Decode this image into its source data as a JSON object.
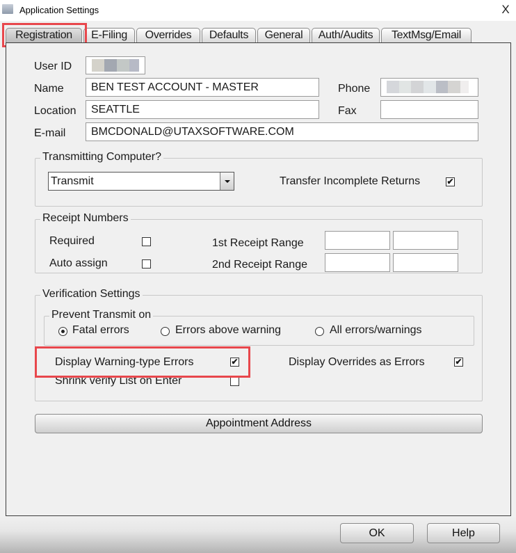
{
  "window": {
    "title": "Application Settings",
    "close_glyph": "X",
    "icon": "app-window-icon"
  },
  "tabs": [
    {
      "label": "Registration",
      "active": true,
      "highlighted": true
    },
    {
      "label": "E-Filing",
      "active": false
    },
    {
      "label": "Overrides",
      "active": false
    },
    {
      "label": "Defaults",
      "active": false
    },
    {
      "label": "General",
      "active": false
    },
    {
      "label": "Auth/Audits",
      "active": false
    },
    {
      "label": "TextMsg/Email",
      "active": false
    }
  ],
  "user": {
    "user_id_label": "User ID",
    "user_id_value": "",
    "user_id_redacted": true,
    "name_label": "Name",
    "name_value": "BEN TEST ACCOUNT - MASTER",
    "phone_label": "Phone",
    "phone_value": "",
    "phone_redacted": true,
    "location_label": "Location",
    "location_value": "SEATTLE",
    "fax_label": "Fax",
    "fax_value": "",
    "email_label": "E-mail",
    "email_value": "BMCDONALD@UTAXSOFTWARE.COM"
  },
  "transmitting": {
    "group_title": "Transmitting Computer?",
    "selected": "Transmit",
    "transfer_incomplete_label": "Transfer Incomplete Returns",
    "transfer_incomplete_checked": true
  },
  "receipt": {
    "group_title": "Receipt Numbers",
    "required_label": "Required",
    "required_checked": false,
    "auto_assign_label": "Auto assign",
    "auto_assign_checked": false,
    "range1_label": "1st Receipt Range",
    "range1_from": "",
    "range1_to": "",
    "range2_label": "2nd Receipt Range",
    "range2_from": "",
    "range2_to": ""
  },
  "verification": {
    "group_title": "Verification Settings",
    "prevent_title": "Prevent Transmit on",
    "options": [
      {
        "label": "Fatal errors",
        "selected": true
      },
      {
        "label": "Errors above warning",
        "selected": false
      },
      {
        "label": "All errors/warnings",
        "selected": false
      }
    ],
    "display_warning_label": "Display Warning-type Errors",
    "display_warning_checked": true,
    "display_overrides_label": "Display Overrides as Errors",
    "display_overrides_checked": true,
    "shrink_label": "Shrink verify List on Enter",
    "shrink_checked": false
  },
  "buttons": {
    "appointment": "Appointment Address",
    "ok": "OK",
    "help": "Help"
  },
  "colors": {
    "highlight": "#e8474c",
    "background": "#f0f0f0"
  },
  "check_glyph": "✔"
}
